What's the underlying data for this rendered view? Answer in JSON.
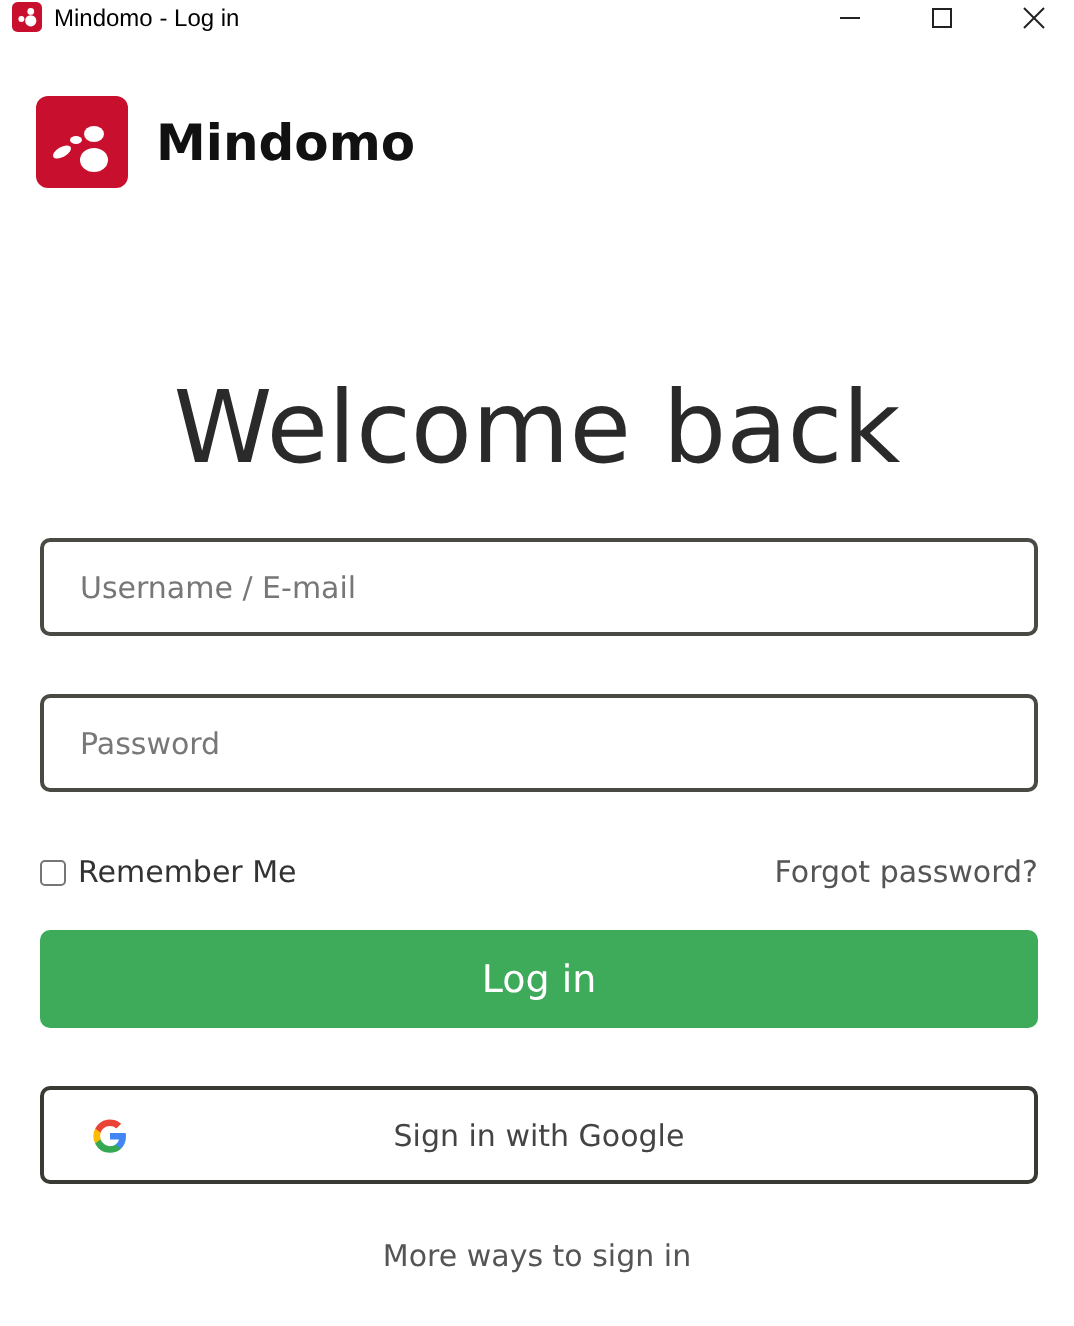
{
  "window": {
    "title": "Mindomo - Log in"
  },
  "brand": {
    "name": "Mindomo"
  },
  "heading": "Welcome back",
  "fields": [
    {
      "placeholder": "Username / E-mail"
    },
    {
      "placeholder": "Password"
    }
  ],
  "remember": {
    "label": "Remember Me",
    "checked": false
  },
  "forgot_link": "Forgot password?",
  "login_button": "Log in",
  "google_button": "Sign in with Google",
  "more_link": "More ways to sign in"
}
